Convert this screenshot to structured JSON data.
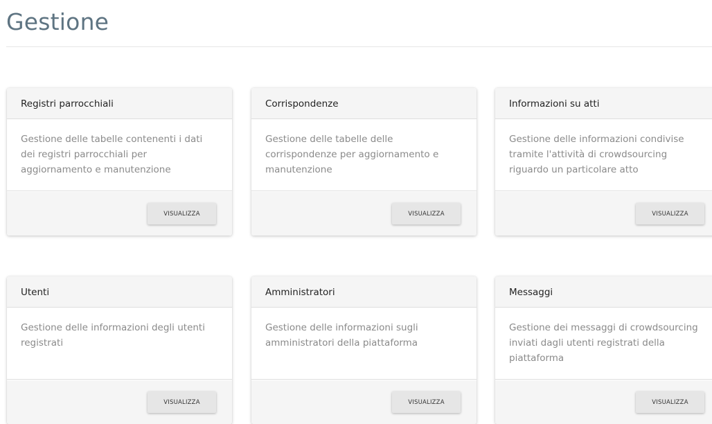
{
  "page": {
    "title": "Gestione"
  },
  "cards": [
    {
      "title": "Registri parrocchiali",
      "description": "Gestione delle tabelle contenenti i dati dei registri parrocchiali per aggiornamento e manutenzione",
      "button_label": "VISUALIZZA"
    },
    {
      "title": "Corrispondenze",
      "description": "Gestione delle tabelle delle corrispondenze per aggiornamento e manutenzione",
      "button_label": "VISUALIZZA"
    },
    {
      "title": "Informazioni su atti",
      "description": "Gestione delle informazioni condivise tramite l'attività di crowdsourcing riguardo un particolare atto",
      "button_label": "VISUALIZZA"
    },
    {
      "title": "Utenti",
      "description": "Gestione delle informazioni degli utenti registrati",
      "button_label": "VISUALIZZA"
    },
    {
      "title": "Amministratori",
      "description": "Gestione delle informazioni sugli amministratori della piattaforma",
      "button_label": "VISUALIZZA"
    },
    {
      "title": "Messaggi",
      "description": "Gestione dei messaggi di crowdsourcing inviati dagli utenti registrati della piattaforma",
      "button_label": "VISUALIZZA"
    }
  ]
}
